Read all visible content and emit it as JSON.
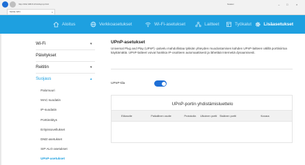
{
  "browser": {
    "url": "http://192.168.8.1/html/upnp.html",
    "address_right": "huawei",
    "tab_title": "Mobile WiFi",
    "tab_close": "×",
    "window_controls": {
      "minimize": "–",
      "maximize": "□",
      "close": "×"
    }
  },
  "topnav": {
    "items": [
      {
        "label": "Aloitus",
        "icon": "home-icon"
      },
      {
        "label": "Verkkoasetukset",
        "icon": "globe-icon"
      },
      {
        "label": "Wi-Fi-asetukset",
        "icon": "wifi-icon"
      },
      {
        "label": "Laitteet",
        "icon": "devices-icon"
      },
      {
        "label": "Työkalut",
        "icon": "tools-icon"
      },
      {
        "label": "Lisäasetukset",
        "icon": "gear-icon",
        "active": true
      }
    ]
  },
  "sidebar": {
    "sections": [
      {
        "label": "Wi-Fi",
        "caret": "▾"
      },
      {
        "label": "Päivitykset",
        "caret": ""
      },
      {
        "label": "Reititin",
        "caret": "▾"
      },
      {
        "label": "Suojaus",
        "caret": "▴",
        "open": true
      }
    ],
    "sub_items": [
      {
        "label": "Palomuuri"
      },
      {
        "label": "MAC-suodatin"
      },
      {
        "label": "IP-suodatin"
      },
      {
        "label": "Porttireititys"
      },
      {
        "label": "Erityissovellukset"
      },
      {
        "label": "DMZ-asetukset"
      },
      {
        "label": "SIP ALG-asetukset"
      },
      {
        "label": "UPnP-asetukset",
        "active": true
      }
    ]
  },
  "main": {
    "title": "UPnP-asetukset",
    "description": "Universal Plug and Play (UPnP) -palvelu mahdollistaa tykkiän yhteyden muodostamisen kahden UPnP-laitteen välillä porttisiirtoa käyttämättä. UPnP-laitteet voivat hankkia IP-osoitteen automaattisesti ja lähettää Internetiä dynaamisesti.",
    "toggle": {
      "label": "UPnP-tila",
      "on": true
    },
    "table": {
      "title": "UPnP-portin yhdistämisluettelo",
      "columns": [
        "Etäosoite",
        "Paikallinen osoite",
        "Protokolla",
        "Ulkoinen portti",
        "Sisäinen portti",
        "Kuvaus"
      ]
    }
  },
  "colors": {
    "topnav_bg": "#1ea0e0",
    "accent": "#1ea0e0",
    "toggle_on": "#1e6fd6"
  }
}
